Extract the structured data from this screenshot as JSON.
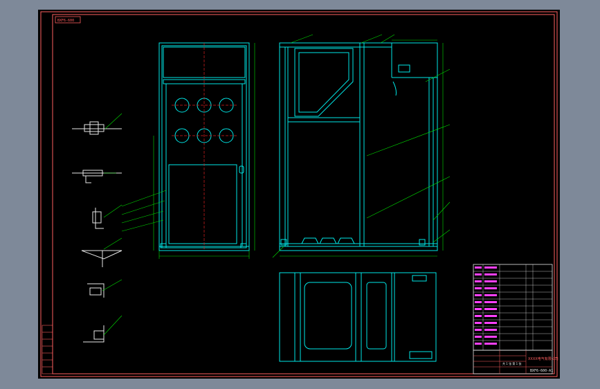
{
  "viewport": {
    "background": "#7e8999",
    "canvas_color": "#000000"
  },
  "colors": {
    "frame": "#ff5f5f",
    "geometry": "#00e8e8",
    "dimension": "#00e000",
    "centerline": "#e02020",
    "table_text": "#ff40ff",
    "white": "#e8e8e8"
  },
  "drawing": {
    "title_tag": "BXF6-600",
    "drawing_number": "BXF6-600-A1",
    "views": [
      "front-view",
      "side-section-view",
      "top-view",
      "detail-views"
    ]
  },
  "title_block": {
    "company": "XXXX电气有限公司",
    "sheet_text": "共 1 张 第 1 张"
  }
}
